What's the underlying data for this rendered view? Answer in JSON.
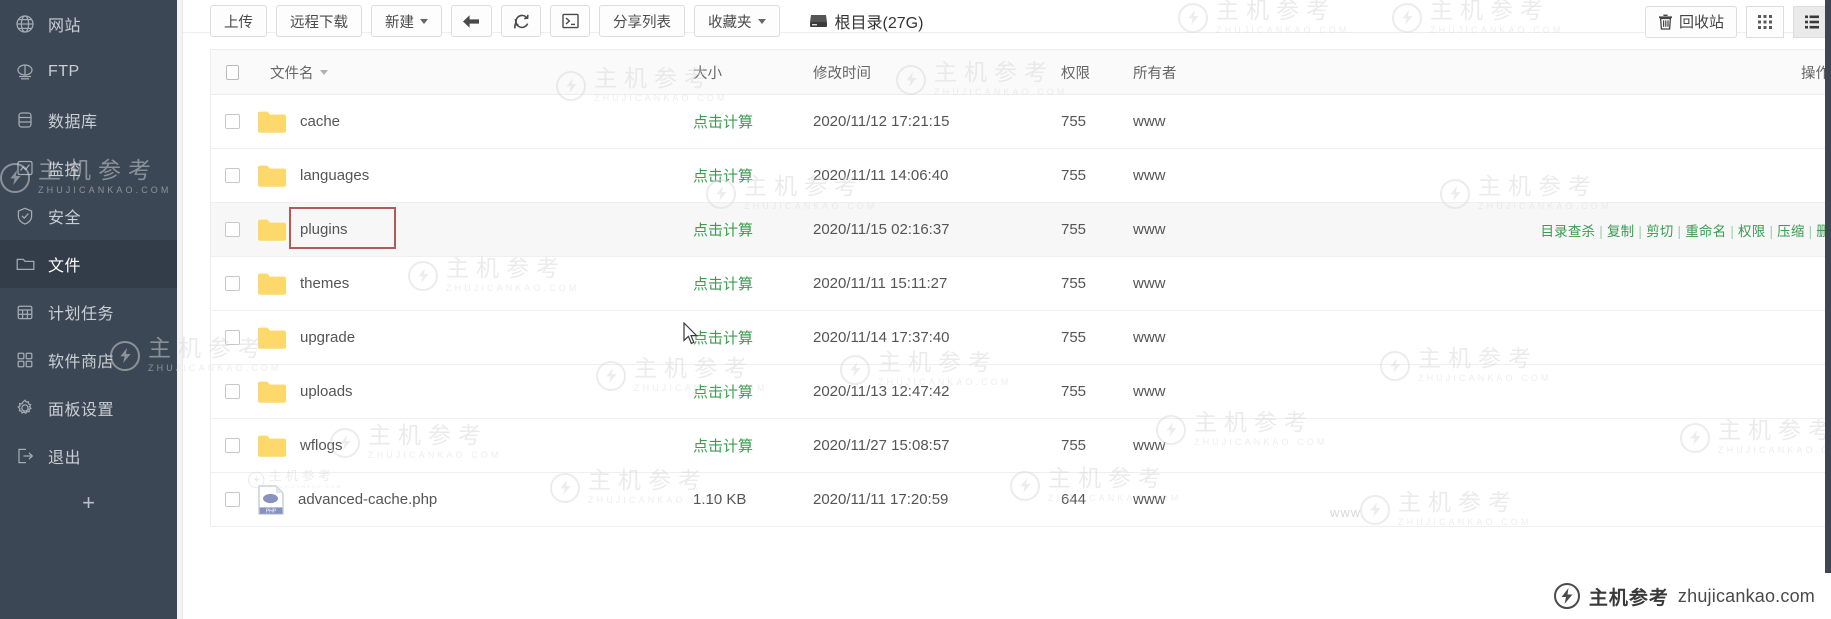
{
  "sidebar": {
    "items": [
      {
        "label": "网站",
        "icon": "globe-icon",
        "active": false
      },
      {
        "label": "FTP",
        "icon": "ftp-icon",
        "active": false
      },
      {
        "label": "数据库",
        "icon": "database-icon",
        "active": false
      },
      {
        "label": "监控",
        "icon": "monitor-icon",
        "active": false
      },
      {
        "label": "安全",
        "icon": "shield-icon",
        "active": false
      },
      {
        "label": "文件",
        "icon": "folder-icon",
        "active": true
      },
      {
        "label": "计划任务",
        "icon": "calendar-icon",
        "active": false
      },
      {
        "label": "软件商店",
        "icon": "apps-icon",
        "active": false
      },
      {
        "label": "面板设置",
        "icon": "gear-icon",
        "active": false
      },
      {
        "label": "退出",
        "icon": "logout-icon",
        "active": false
      }
    ],
    "add_label": "+"
  },
  "toolbar": {
    "buttons": [
      {
        "label": "上传",
        "icon": null,
        "caret": false
      },
      {
        "label": "远程下载",
        "icon": null,
        "caret": false
      },
      {
        "label": "新建",
        "icon": null,
        "caret": true
      },
      {
        "label": "",
        "icon": "back-arrow-icon",
        "caret": false
      },
      {
        "label": "",
        "icon": "refresh-icon",
        "caret": false
      },
      {
        "label": "",
        "icon": "terminal-icon",
        "caret": false
      },
      {
        "label": "分享列表",
        "icon": null,
        "caret": false
      },
      {
        "label": "收藏夹",
        "icon": null,
        "caret": true
      }
    ],
    "root_dir": "根目录(27G)",
    "recycle_label": "回收站",
    "view_grid_label": "grid-view-icon",
    "view_list_label": "list-view-icon"
  },
  "table": {
    "headers": {
      "filename": "文件名",
      "size": "大小",
      "mtime": "修改时间",
      "perm": "权限",
      "owner": "所有者",
      "ops": "操作"
    },
    "rows": [
      {
        "name": "cache",
        "type": "folder",
        "size": "点击计算",
        "size_is_link": true,
        "mtime": "2020/11/12 17:21:15",
        "perm": "755",
        "owner": "www",
        "ops": [],
        "highlight": false
      },
      {
        "name": "languages",
        "type": "folder",
        "size": "点击计算",
        "size_is_link": true,
        "mtime": "2020/11/11 14:06:40",
        "perm": "755",
        "owner": "www",
        "ops": [],
        "highlight": false
      },
      {
        "name": "plugins",
        "type": "folder",
        "size": "点击计算",
        "size_is_link": true,
        "mtime": "2020/11/15 02:16:37",
        "perm": "755",
        "owner": "www",
        "ops": [
          "目录查杀",
          "复制",
          "剪切",
          "重命名",
          "权限",
          "压缩",
          "删"
        ],
        "highlight": true
      },
      {
        "name": "themes",
        "type": "folder",
        "size": "点击计算",
        "size_is_link": true,
        "mtime": "2020/11/11 15:11:27",
        "perm": "755",
        "owner": "www",
        "ops": [],
        "highlight": false
      },
      {
        "name": "upgrade",
        "type": "folder",
        "size": "点击计算",
        "size_is_link": true,
        "mtime": "2020/11/14 17:37:40",
        "perm": "755",
        "owner": "www",
        "ops": [],
        "highlight": false
      },
      {
        "name": "uploads",
        "type": "folder",
        "size": "点击计算",
        "size_is_link": true,
        "mtime": "2020/11/13 12:47:42",
        "perm": "755",
        "owner": "www",
        "ops": [],
        "highlight": false
      },
      {
        "name": "wflogs",
        "type": "folder",
        "size": "点击计算",
        "size_is_link": true,
        "mtime": "2020/11/27 15:08:57",
        "perm": "755",
        "owner": "www",
        "ops": [],
        "highlight": false
      },
      {
        "name": "advanced-cache.php",
        "type": "php",
        "size": "1.10 KB",
        "size_is_link": false,
        "mtime": "2020/11/11 17:20:59",
        "perm": "644",
        "owner": "www",
        "ops": [],
        "highlight": false
      }
    ]
  },
  "watermark": {
    "cn": "主机参考",
    "en": "ZHUJICANKAO.COM",
    "www": "www"
  },
  "brand_badge": {
    "cn": "主机参考",
    "url": "zhujicankao.com"
  },
  "colors": {
    "sidebar_bg": "#3b4754",
    "sidebar_active": "#333d49",
    "link_green": "#3c9a52",
    "folder_yellow": "#fcd96a",
    "highlight_border": "#b05a5a"
  }
}
